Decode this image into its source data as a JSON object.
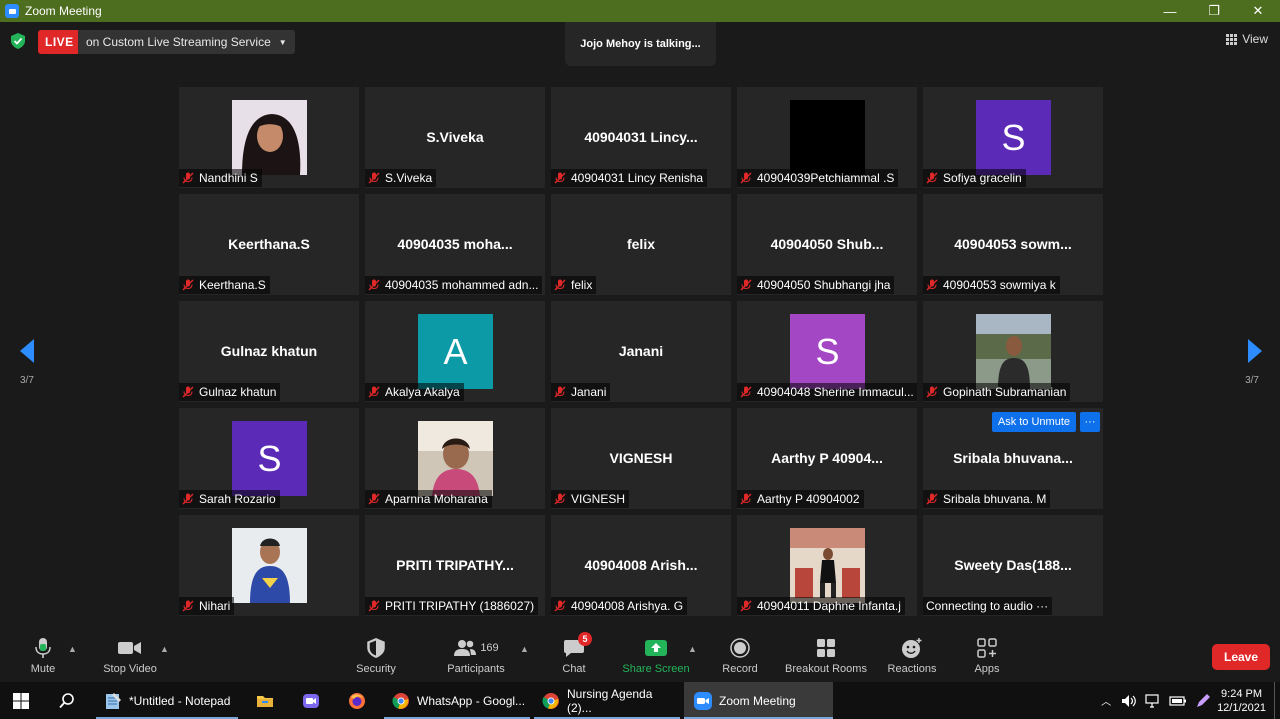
{
  "window": {
    "title": "Zoom Meeting",
    "min": "—",
    "max": "❐",
    "close": "✕"
  },
  "header": {
    "live": "LIVE",
    "service": "on Custom Live Streaming Service",
    "talking": "Jojo Mehoy is talking...",
    "view": "View"
  },
  "nav": {
    "page_left": "3/7",
    "page_right": "3/7"
  },
  "tiles": [
    {
      "big": "",
      "avatar": "",
      "label": "Nandhini S",
      "photo": "photo-girl"
    },
    {
      "big": "S.Viveka",
      "avatar": "",
      "label": "S.Viveka"
    },
    {
      "big": "40904031 Lincy...",
      "avatar": "",
      "label": "40904031 Lincy Renisha"
    },
    {
      "big": "",
      "avatar": "",
      "label": "40904039Petchiammal .S",
      "photo": "black"
    },
    {
      "big": "",
      "avatar": "S",
      "label": "Sofiya gracelin",
      "avatar_color": "#5b2bb8"
    },
    {
      "big": "Keerthana.S",
      "avatar": "",
      "label": "Keerthana.S"
    },
    {
      "big": "40904035 moha...",
      "avatar": "",
      "label": "40904035 mohammed adn..."
    },
    {
      "big": "felix",
      "avatar": "",
      "label": "felix"
    },
    {
      "big": "40904050 Shub...",
      "avatar": "",
      "label": "40904050 Shubhangi jha"
    },
    {
      "big": "40904053 sowm...",
      "avatar": "",
      "label": "40904053 sowmiya k"
    },
    {
      "big": "Gulnaz khatun",
      "avatar": "",
      "label": "Gulnaz khatun"
    },
    {
      "big": "",
      "avatar": "A",
      "label": "Akalya Akalya",
      "avatar_color": "#0b9aa6"
    },
    {
      "big": "Janani",
      "avatar": "",
      "label": "Janani"
    },
    {
      "big": "",
      "avatar": "S",
      "label": "40904048 Sherine Immacul...",
      "avatar_color": "#a447c4"
    },
    {
      "big": "",
      "avatar": "",
      "label": "Gopinath Subramanian",
      "photo": "photo-man"
    },
    {
      "big": "",
      "avatar": "S",
      "label": "Sarah Rozario",
      "avatar_color": "#5b2bb8"
    },
    {
      "big": "",
      "avatar": "",
      "label": "Aparnna Moharana",
      "photo": "photo-woman"
    },
    {
      "big": "VIGNESH",
      "avatar": "",
      "label": "VIGNESH"
    },
    {
      "big": "Aarthy P 40904...",
      "avatar": "",
      "label": "Aarthy P 40904002"
    },
    {
      "big": "Sribala  bhuvana...",
      "avatar": "",
      "label": "Sribala bhuvana. M",
      "ask_unmute": "Ask to Unmute",
      "more": "···"
    },
    {
      "big": "",
      "avatar": "",
      "label": "Nihari",
      "photo": "photo-boy"
    },
    {
      "big": "PRITI  TRIPATHY...",
      "avatar": "",
      "label": "PRITI TRIPATHY (1886027)"
    },
    {
      "big": "40904008 Arish...",
      "avatar": "",
      "label": "40904008 Arishya. G"
    },
    {
      "big": "",
      "avatar": "",
      "label": "40904011 Daphne Infanta.j",
      "photo": "photo-cafe"
    },
    {
      "big": "Sweety  Das(188...",
      "avatar": "",
      "label": "Connecting to audio ···",
      "no_mute": true
    }
  ],
  "toolbar": {
    "mute": "Mute",
    "stop_video": "Stop Video",
    "security": "Security",
    "participants": "Participants",
    "participants_count": "169",
    "chat": "Chat",
    "chat_badge": "5",
    "share": "Share Screen",
    "record": "Record",
    "breakout": "Breakout Rooms",
    "reactions": "Reactions",
    "apps": "Apps",
    "leave": "Leave"
  },
  "taskbar": {
    "notepad": "*Untitled - Notepad",
    "whatsapp": "WhatsApp - Googl...",
    "nursing": "Nursing Agenda (2)...",
    "zoom": "Zoom Meeting",
    "time": "9:24 PM",
    "date": "12/1/2021"
  }
}
